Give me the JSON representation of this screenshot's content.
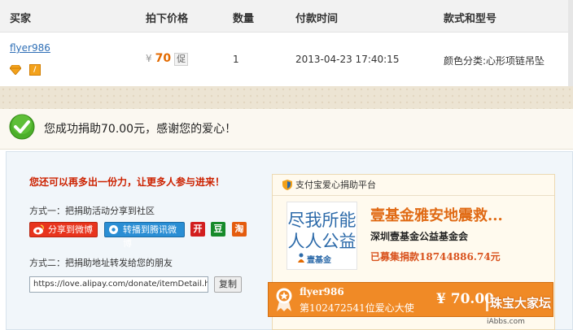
{
  "colors": {
    "accent_orange": "#e36a00",
    "link_blue": "#2f6fb6",
    "invite_red": "#cc2200",
    "weibo_red": "#e8341d",
    "tencent_blue": "#2a8ed4",
    "banner_orange": "#f08a26"
  },
  "table": {
    "headers": {
      "buyer": "买家",
      "price": "拍下价格",
      "qty": "数量",
      "paid_time": "付款时间",
      "style": "款式和型号"
    },
    "row": {
      "buyer": "flyer986",
      "price_currency": "¥",
      "price": "70",
      "promo": "促",
      "qty": "1",
      "paid_time": "2013-04-23 17:40:15",
      "style": "颜色分类:心形项链吊坠"
    }
  },
  "success": {
    "message": "您成功捐助70.00元，感谢您的爱心！",
    "icon": "check-icon"
  },
  "share": {
    "invite": "您还可以再多出一份力，让更多人参与进来！",
    "method1": "方式一：把捐助活动分享到社区",
    "weibo_button": "分享到微博",
    "tencent_button": "转播到腾讯微博",
    "kai": "开",
    "dou": "豆",
    "tao": "淘",
    "method2": "方式二：把捐助地址转发给您的朋友",
    "url_value": "https://love.alipay.com/donate/itemDetail.htm?na",
    "copy_button": "复制"
  },
  "card": {
    "header": "支付宝爱心捐助平台",
    "logo_line1": "尽我所能",
    "logo_line2": "人人公益",
    "logo_foot": "壹基金",
    "title": "壹基金雅安地震救...",
    "org": "深圳壹基金公益基金会",
    "raised": "已募集捐款18744886.74元"
  },
  "banner": {
    "name": "flyer986",
    "rank": "第102472541位爱心大使",
    "amount": "¥ 70.00"
  },
  "watermark": {
    "text": "珠宝大家坛",
    "domain": "iAbbs.com"
  }
}
